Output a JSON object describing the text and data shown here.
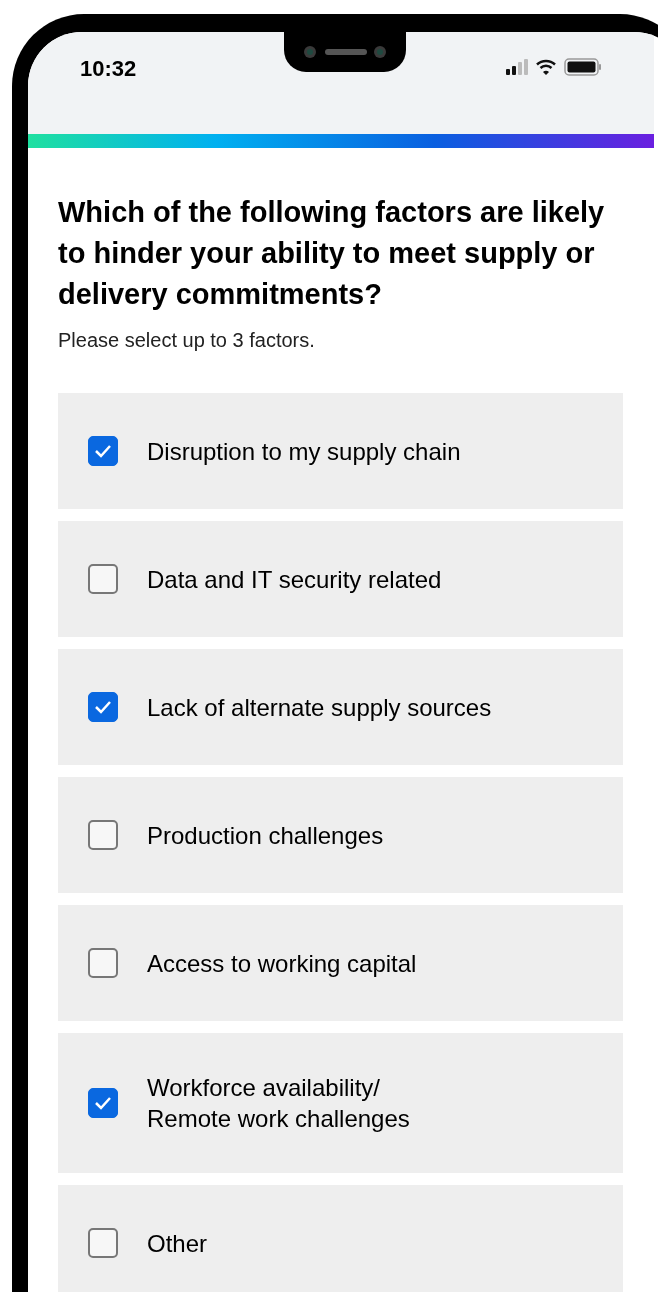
{
  "status_bar": {
    "time": "10:32"
  },
  "progress": {
    "level": 1
  },
  "question": {
    "title": "Which of the following factors are likely to hinder your ability to meet supply or delivery commitments?",
    "hint": "Please select up to 3 factors."
  },
  "options": [
    {
      "label": "Disruption to my supply chain",
      "checked": true
    },
    {
      "label": "Data and IT security related",
      "checked": false
    },
    {
      "label": "Lack of alternate supply sources",
      "checked": true
    },
    {
      "label": "Production challenges",
      "checked": false
    },
    {
      "label": "Access to working capital",
      "checked": false
    },
    {
      "label": "Workforce availability/\nRemote work challenges",
      "checked": true
    },
    {
      "label": "Other",
      "checked": false
    }
  ]
}
